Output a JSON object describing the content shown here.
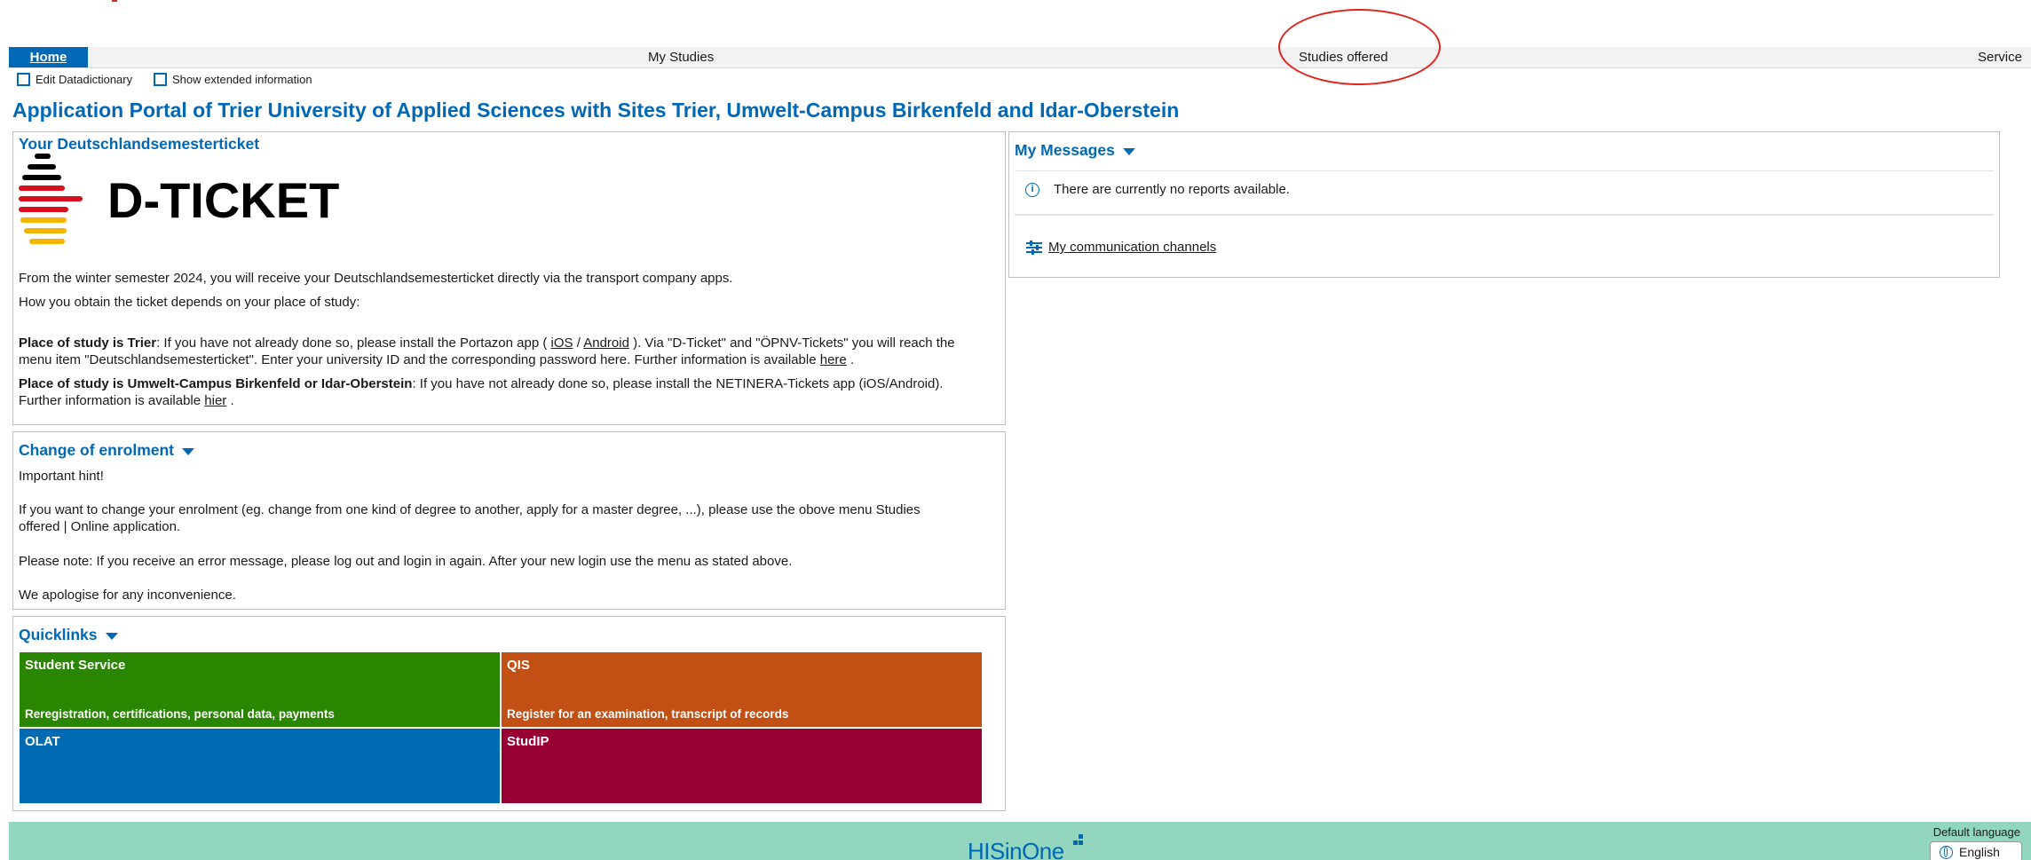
{
  "nav": {
    "home": "Home",
    "my_studies": "My Studies",
    "studies_offered": "Studies offered",
    "service": "Service"
  },
  "toggles": {
    "edit_datadictionary": "Edit Datadictionary",
    "show_extended": "Show extended information"
  },
  "page_title": "Application Portal of Trier University of Applied Sciences with Sites Trier, Umwelt-Campus Birkenfeld and Idar-Oberstein",
  "dticket": {
    "title": "Your Deutschlandsemesterticket",
    "logo_text": "D-TICKET",
    "intro1": "From the winter semester 2024, you will receive your Deutschlandsemesterticket directly via the transport company apps.",
    "intro2": "How you obtain the ticket depends on your place of study:",
    "trier_label": "Place of study is Trier",
    "trier_text_a": ": If you have not already done so, please install the Portazon app ( ",
    "ios_link": "iOS",
    "slash": " / ",
    "android_link": "Android",
    "trier_text_b": " ). Via \"D-Ticket\" and \"ÖPNV-Tickets\" you will reach the",
    "trier_text_c": "menu item \"Deutschlandsemesterticket\". Enter your university ID and the corresponding password here. Further information is available ",
    "here_link": "here",
    "period": " .",
    "ucb_label": "Place of study is Umwelt-Campus Birkenfeld or Idar-Oberstein",
    "ucb_text_a": ": If you have not already done so, please install the NETINERA-Tickets app (iOS/Android).",
    "ucb_text_b": "Further information is available ",
    "hier_link": "hier"
  },
  "enrolment": {
    "title": "Change of enrolment",
    "hint": "Important hint!",
    "line1": "If you want to change your enrolment (eg. change from one kind of degree to another, apply for a master degree, ...), please use the obove menu Studies",
    "line2": "offered | Online application.",
    "line3": "Please note: If you receive an error message, please log out and login in again. After your new login use the menu as stated above.",
    "line4": "We apologise for any inconvenience."
  },
  "quicklinks": {
    "title": "Quicklinks",
    "tiles": [
      {
        "title": "Student Service",
        "subtitle": "Reregistration, certifications, personal data, payments",
        "color": "#2a8600"
      },
      {
        "title": "QIS",
        "subtitle": "Register for an examination, transcript of records",
        "color": "#c24f14"
      },
      {
        "title": "OLAT",
        "subtitle": "",
        "color": "#006ab3"
      },
      {
        "title": "StudIP",
        "subtitle": "",
        "color": "#980034"
      }
    ]
  },
  "messages": {
    "title": "My Messages",
    "empty": "There are currently no reports available.",
    "channels": "My communication channels"
  },
  "footer": {
    "logo": "HISinOne",
    "language_label": "Default language",
    "language_value": "English"
  },
  "colors": {
    "accent": "#0068b4",
    "footer": "#92d6c0",
    "annotation": "#e0231c"
  }
}
